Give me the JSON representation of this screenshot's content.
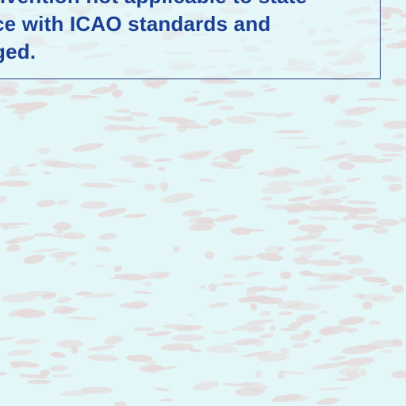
{
  "document": {
    "notice_lines": [
      "nvention not applicable to state",
      "ce with ICAO standards and",
      "ged."
    ]
  },
  "colors": {
    "background": "#e4f7f8",
    "text": "#1b3f93",
    "border": "#243c7a",
    "security_pattern": "#e5d9da"
  }
}
